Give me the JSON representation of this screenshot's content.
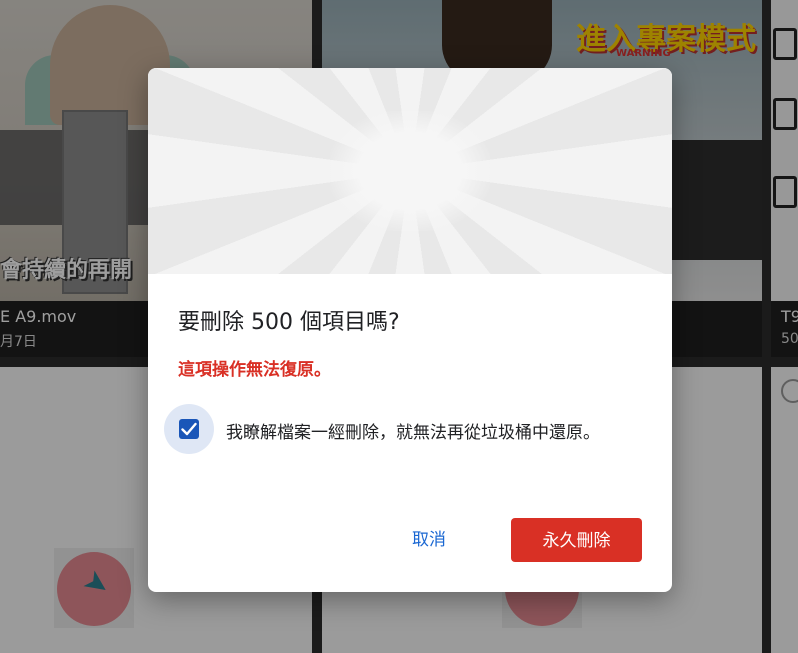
{
  "background": {
    "tiles": [
      {
        "name": "E A9.mov",
        "date": "月7日",
        "overlay_text": "會持續的再開"
      },
      {
        "overlay_text": "進入專案模式",
        "overlay_sub": "WARNING"
      },
      {
        "name": "T9",
        "date": "50"
      }
    ]
  },
  "dialog": {
    "title": "要刪除 500 個項目嗎?",
    "warning": "這項操作無法復原。",
    "checkbox": {
      "label": "我瞭解檔案一經刪除，就無法再從垃圾桶中還原。",
      "checked": true
    },
    "cancel_label": "取消",
    "delete_label": "永久刪除"
  },
  "colors": {
    "accent_blue": "#1a67d2",
    "checkbox_blue": "#1a56b8",
    "danger_red": "#d93025"
  },
  "icons": {
    "checkbox": "checkmark-icon",
    "thumbnail": "rocket-icon"
  }
}
